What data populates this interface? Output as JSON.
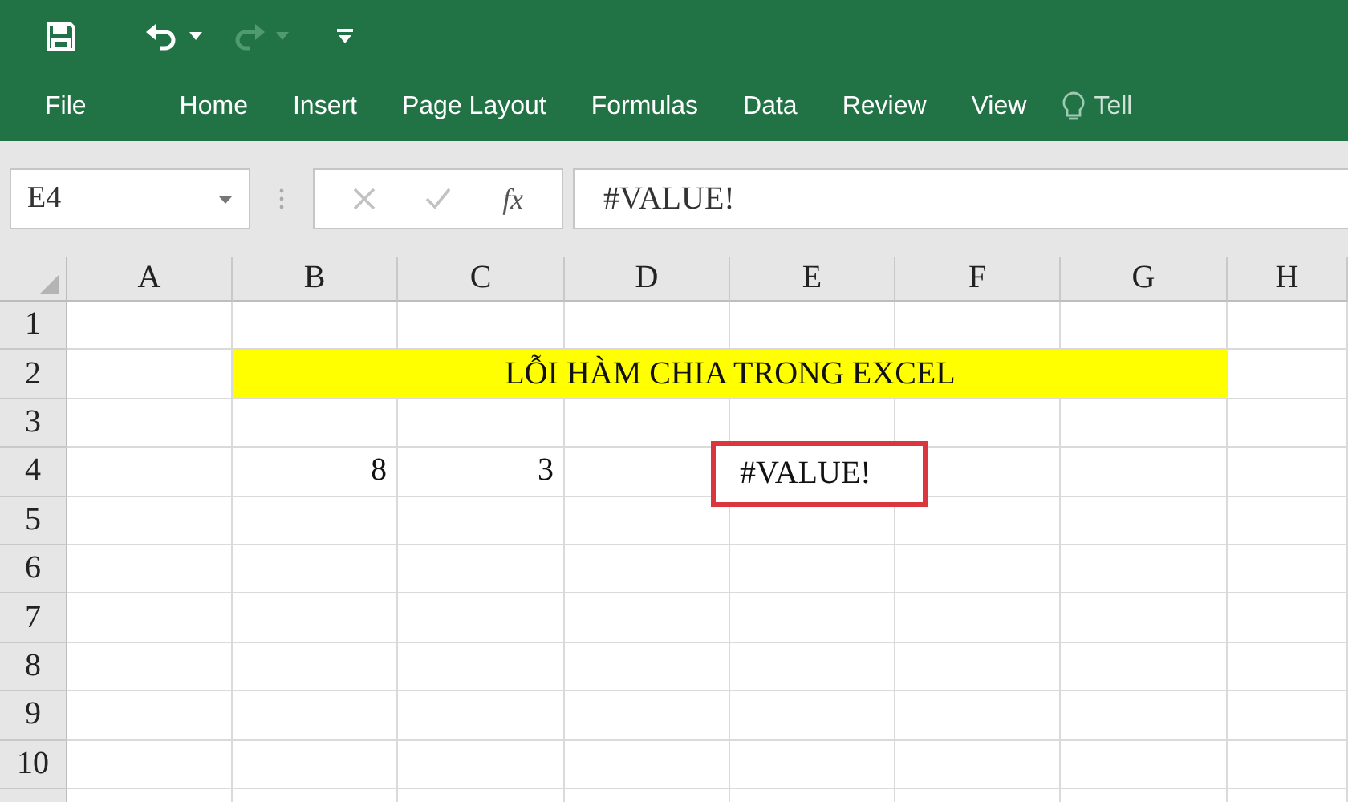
{
  "ribbon_tabs": [
    "File",
    "Home",
    "Insert",
    "Page Layout",
    "Formulas",
    "Data",
    "Review",
    "View"
  ],
  "tell_me": "Tell",
  "name_box": "E4",
  "function_button": "fx",
  "formula": "#VALUE!",
  "columns": [
    "A",
    "B",
    "C",
    "D",
    "E",
    "F",
    "G",
    "H"
  ],
  "rows": [
    {
      "number": "1",
      "cells": []
    },
    {
      "number": "2",
      "cells": [
        {
          "kind": "empty"
        },
        {
          "kind": "banner",
          "text": "LỖI HÀM CHIA TRONG EXCEL",
          "highlighted": false
        }
      ]
    },
    {
      "number": "3",
      "cells": []
    },
    {
      "number": "4",
      "cells": [
        {
          "kind": "empty"
        },
        {
          "kind": "number",
          "text": "8",
          "highlighted": false
        },
        {
          "kind": "number",
          "text": "3",
          "highlighted": false
        },
        {
          "kind": "empty"
        },
        {
          "kind": "error",
          "text": "#VALUE!",
          "highlighted": true
        }
      ]
    },
    {
      "number": "5",
      "cells": []
    },
    {
      "number": "6",
      "cells": []
    },
    {
      "number": "7",
      "cells": []
    },
    {
      "number": "8",
      "cells": []
    },
    {
      "number": "9",
      "cells": []
    },
    {
      "number": "10",
      "cells": []
    }
  ]
}
